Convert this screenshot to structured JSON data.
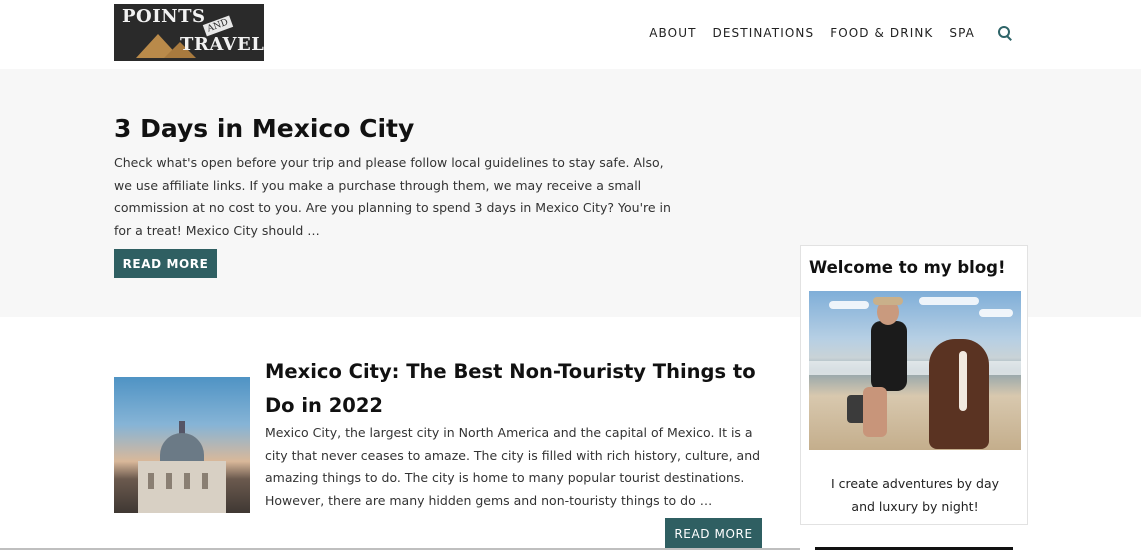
{
  "logo": {
    "word1": "POINTS",
    "word2": "AND",
    "word3": "TRAVEL"
  },
  "nav": {
    "items": [
      "ABOUT",
      "DESTINATIONS",
      "FOOD & DRINK",
      "SPA"
    ],
    "search_icon": "search-icon"
  },
  "hero": {
    "title": "3 Days in Mexico City",
    "excerpt": "Check what's open before your trip and please follow local guidelines to stay safe. Also, we use affiliate links. If you make a purchase through them, we may receive a small commission at no cost to you. Are you planning to spend 3 days in Mexico City? You're in for a treat! Mexico City should …",
    "button": "READ MORE"
  },
  "post": {
    "title": "Mexico City: The Best Non-Touristy Things to Do in 2022",
    "excerpt": "Mexico City, the largest city in North America and the capital of Mexico. It is a city that never ceases to amaze. The city is filled with rich history, culture, and amazing things to do. The city is home to many popular tourist destinations. However, there are many hidden gems and non-touristy things to do …",
    "button": "READ MORE"
  },
  "sidebar": {
    "title": "Welcome to my blog!",
    "text_line1": "I create adventures by day",
    "text_line2": "and luxury by night!"
  },
  "colors": {
    "accent": "#2f5f62",
    "hero_bg": "#f7f7f7",
    "text": "#222222"
  }
}
